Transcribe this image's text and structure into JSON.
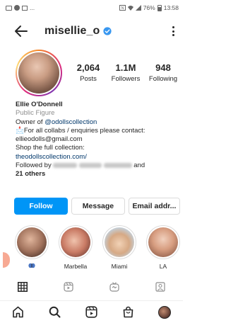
{
  "status_bar": {
    "left_text": "...",
    "right_text": "76%",
    "time": "13:58"
  },
  "header": {
    "username": "misellie_o",
    "verified": true,
    "back_icon": "arrow-left-icon",
    "menu_icon": "more-vertical-icon"
  },
  "stats": {
    "posts_count": "2,064",
    "posts_label": "Posts",
    "followers_count": "1.1M",
    "followers_label": "Followers",
    "following_count": "948",
    "following_label": "Following"
  },
  "bio": {
    "name": "Ellie O'Donnell",
    "category": "Public Figure",
    "owner_prefix": "Owner of ",
    "owner_handle": "@odollscollection",
    "collab_emoji": "📩",
    "collab_text": "For all collabs / enquiries please contact:",
    "email": "ellieodolls@gmail.com",
    "shop_text": "Shop the full collection:",
    "shop_link": "theodollscollection.com/",
    "followed_prefix": "Followed by ",
    "followed_suffix": "and",
    "others": "21 others"
  },
  "actions": {
    "follow_label": "Follow",
    "message_label": "Message",
    "email_label": "Email addr..."
  },
  "highlights": [
    {
      "label": "",
      "has_emoji": true
    },
    {
      "label": "Marbella"
    },
    {
      "label": "Miami"
    },
    {
      "label": "LA"
    }
  ],
  "profile_tabs": [
    "grid-icon",
    "reels-icon",
    "igtv-icon",
    "tagged-icon"
  ],
  "bottom_nav": [
    "home-icon",
    "search-icon",
    "reels-icon",
    "shop-icon",
    "profile-avatar"
  ],
  "colors": {
    "primary_blue": "#0095f6",
    "link_blue": "#00376b",
    "text": "#262626",
    "muted": "#8e8e8e",
    "border": "#dbdbdb"
  }
}
